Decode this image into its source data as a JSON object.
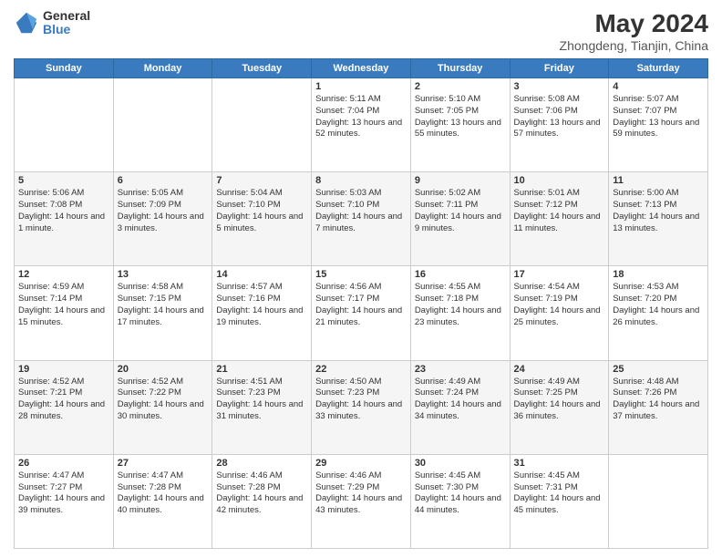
{
  "logo": {
    "general": "General",
    "blue": "Blue"
  },
  "title": "May 2024",
  "subtitle": "Zhongdeng, Tianjin, China",
  "headers": [
    "Sunday",
    "Monday",
    "Tuesday",
    "Wednesday",
    "Thursday",
    "Friday",
    "Saturday"
  ],
  "weeks": [
    [
      {
        "day": "",
        "data": ""
      },
      {
        "day": "",
        "data": ""
      },
      {
        "day": "",
        "data": ""
      },
      {
        "day": "1",
        "data": "Sunrise: 5:11 AM\nSunset: 7:04 PM\nDaylight: 13 hours and 52 minutes."
      },
      {
        "day": "2",
        "data": "Sunrise: 5:10 AM\nSunset: 7:05 PM\nDaylight: 13 hours and 55 minutes."
      },
      {
        "day": "3",
        "data": "Sunrise: 5:08 AM\nSunset: 7:06 PM\nDaylight: 13 hours and 57 minutes."
      },
      {
        "day": "4",
        "data": "Sunrise: 5:07 AM\nSunset: 7:07 PM\nDaylight: 13 hours and 59 minutes."
      }
    ],
    [
      {
        "day": "5",
        "data": "Sunrise: 5:06 AM\nSunset: 7:08 PM\nDaylight: 14 hours and 1 minute."
      },
      {
        "day": "6",
        "data": "Sunrise: 5:05 AM\nSunset: 7:09 PM\nDaylight: 14 hours and 3 minutes."
      },
      {
        "day": "7",
        "data": "Sunrise: 5:04 AM\nSunset: 7:10 PM\nDaylight: 14 hours and 5 minutes."
      },
      {
        "day": "8",
        "data": "Sunrise: 5:03 AM\nSunset: 7:10 PM\nDaylight: 14 hours and 7 minutes."
      },
      {
        "day": "9",
        "data": "Sunrise: 5:02 AM\nSunset: 7:11 PM\nDaylight: 14 hours and 9 minutes."
      },
      {
        "day": "10",
        "data": "Sunrise: 5:01 AM\nSunset: 7:12 PM\nDaylight: 14 hours and 11 minutes."
      },
      {
        "day": "11",
        "data": "Sunrise: 5:00 AM\nSunset: 7:13 PM\nDaylight: 14 hours and 13 minutes."
      }
    ],
    [
      {
        "day": "12",
        "data": "Sunrise: 4:59 AM\nSunset: 7:14 PM\nDaylight: 14 hours and 15 minutes."
      },
      {
        "day": "13",
        "data": "Sunrise: 4:58 AM\nSunset: 7:15 PM\nDaylight: 14 hours and 17 minutes."
      },
      {
        "day": "14",
        "data": "Sunrise: 4:57 AM\nSunset: 7:16 PM\nDaylight: 14 hours and 19 minutes."
      },
      {
        "day": "15",
        "data": "Sunrise: 4:56 AM\nSunset: 7:17 PM\nDaylight: 14 hours and 21 minutes."
      },
      {
        "day": "16",
        "data": "Sunrise: 4:55 AM\nSunset: 7:18 PM\nDaylight: 14 hours and 23 minutes."
      },
      {
        "day": "17",
        "data": "Sunrise: 4:54 AM\nSunset: 7:19 PM\nDaylight: 14 hours and 25 minutes."
      },
      {
        "day": "18",
        "data": "Sunrise: 4:53 AM\nSunset: 7:20 PM\nDaylight: 14 hours and 26 minutes."
      }
    ],
    [
      {
        "day": "19",
        "data": "Sunrise: 4:52 AM\nSunset: 7:21 PM\nDaylight: 14 hours and 28 minutes."
      },
      {
        "day": "20",
        "data": "Sunrise: 4:52 AM\nSunset: 7:22 PM\nDaylight: 14 hours and 30 minutes."
      },
      {
        "day": "21",
        "data": "Sunrise: 4:51 AM\nSunset: 7:23 PM\nDaylight: 14 hours and 31 minutes."
      },
      {
        "day": "22",
        "data": "Sunrise: 4:50 AM\nSunset: 7:23 PM\nDaylight: 14 hours and 33 minutes."
      },
      {
        "day": "23",
        "data": "Sunrise: 4:49 AM\nSunset: 7:24 PM\nDaylight: 14 hours and 34 minutes."
      },
      {
        "day": "24",
        "data": "Sunrise: 4:49 AM\nSunset: 7:25 PM\nDaylight: 14 hours and 36 minutes."
      },
      {
        "day": "25",
        "data": "Sunrise: 4:48 AM\nSunset: 7:26 PM\nDaylight: 14 hours and 37 minutes."
      }
    ],
    [
      {
        "day": "26",
        "data": "Sunrise: 4:47 AM\nSunset: 7:27 PM\nDaylight: 14 hours and 39 minutes."
      },
      {
        "day": "27",
        "data": "Sunrise: 4:47 AM\nSunset: 7:28 PM\nDaylight: 14 hours and 40 minutes."
      },
      {
        "day": "28",
        "data": "Sunrise: 4:46 AM\nSunset: 7:28 PM\nDaylight: 14 hours and 42 minutes."
      },
      {
        "day": "29",
        "data": "Sunrise: 4:46 AM\nSunset: 7:29 PM\nDaylight: 14 hours and 43 minutes."
      },
      {
        "day": "30",
        "data": "Sunrise: 4:45 AM\nSunset: 7:30 PM\nDaylight: 14 hours and 44 minutes."
      },
      {
        "day": "31",
        "data": "Sunrise: 4:45 AM\nSunset: 7:31 PM\nDaylight: 14 hours and 45 minutes."
      },
      {
        "day": "",
        "data": ""
      }
    ]
  ]
}
